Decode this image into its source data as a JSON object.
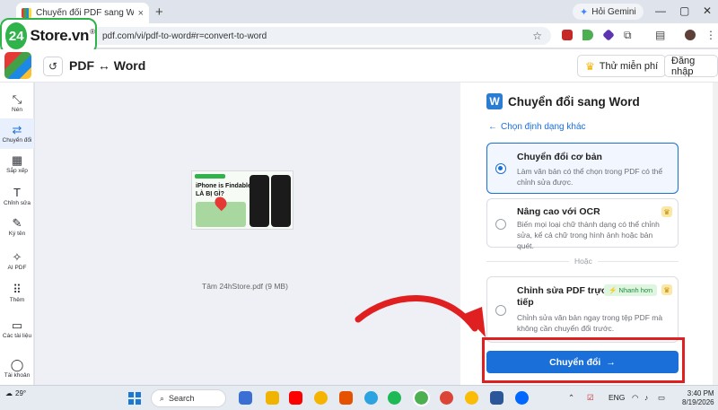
{
  "browser": {
    "tab_title": "Chuyển đổi PDF sang Word - M",
    "new_tab_icon": "plus-icon",
    "gemini_label": "Hỏi Gemini",
    "url": "pdf.com/vi/pdf-to-word#r=convert-to-word"
  },
  "logo": {
    "badge": "24",
    "text": "Store.vn",
    "mark": "®"
  },
  "app": {
    "title": "PDF ↔ Word",
    "free_button": "Thử miễn phí",
    "login_button": "Đăng nhập"
  },
  "sidebar": {
    "items": [
      {
        "label": "Nén",
        "icon": "compress-icon"
      },
      {
        "label": "Chuyển đổi",
        "icon": "convert-icon"
      },
      {
        "label": "Sắp xếp",
        "icon": "organize-icon"
      },
      {
        "label": "Chỉnh sửa",
        "icon": "edit-text-icon"
      },
      {
        "label": "Ký tên",
        "icon": "signature-icon"
      },
      {
        "label": "AI PDF",
        "icon": "ai-sparkle-icon"
      },
      {
        "label": "Thêm",
        "icon": "grid-icon"
      },
      {
        "label": "Các tài liệu",
        "icon": "folder-icon"
      },
      {
        "label": "Tài khoản",
        "icon": "user-icon"
      }
    ]
  },
  "preview": {
    "thumb_heading": "iPhone is Findable LÀ BỊ GÌ?",
    "file_caption": "Tâm 24hStore.pdf (9 MB)"
  },
  "panel": {
    "title": "Chuyển đổi sang Word",
    "back_link": "Chọn định dạng khác",
    "options": [
      {
        "title": "Chuyển đổi cơ bản",
        "desc": "Làm văn bản có thể chọn trong PDF có thể chỉnh sửa được."
      },
      {
        "title": "Nâng cao với OCR",
        "desc": "Biến mọi loại chữ thành dạng có thể chỉnh sửa, kể cả chữ trong hình ảnh hoặc bản quét."
      },
      {
        "title": "Chỉnh sửa PDF trực tiếp",
        "desc": "Chỉnh sửa văn bản ngay trong tệp PDF mà không cần chuyển đổi trước.",
        "badge": "Nhanh hơn"
      }
    ],
    "divider_text": "Hoặc",
    "convert_button": "Chuyển đổi"
  },
  "taskbar": {
    "temperature": "29°",
    "search_label": "Search",
    "language": "ENG",
    "time": "3:40 PM",
    "date": "8/19/2026"
  },
  "colors": {
    "primary": "#1a6fd9",
    "highlight": "#e02020",
    "logo_green": "#2fb34a"
  }
}
